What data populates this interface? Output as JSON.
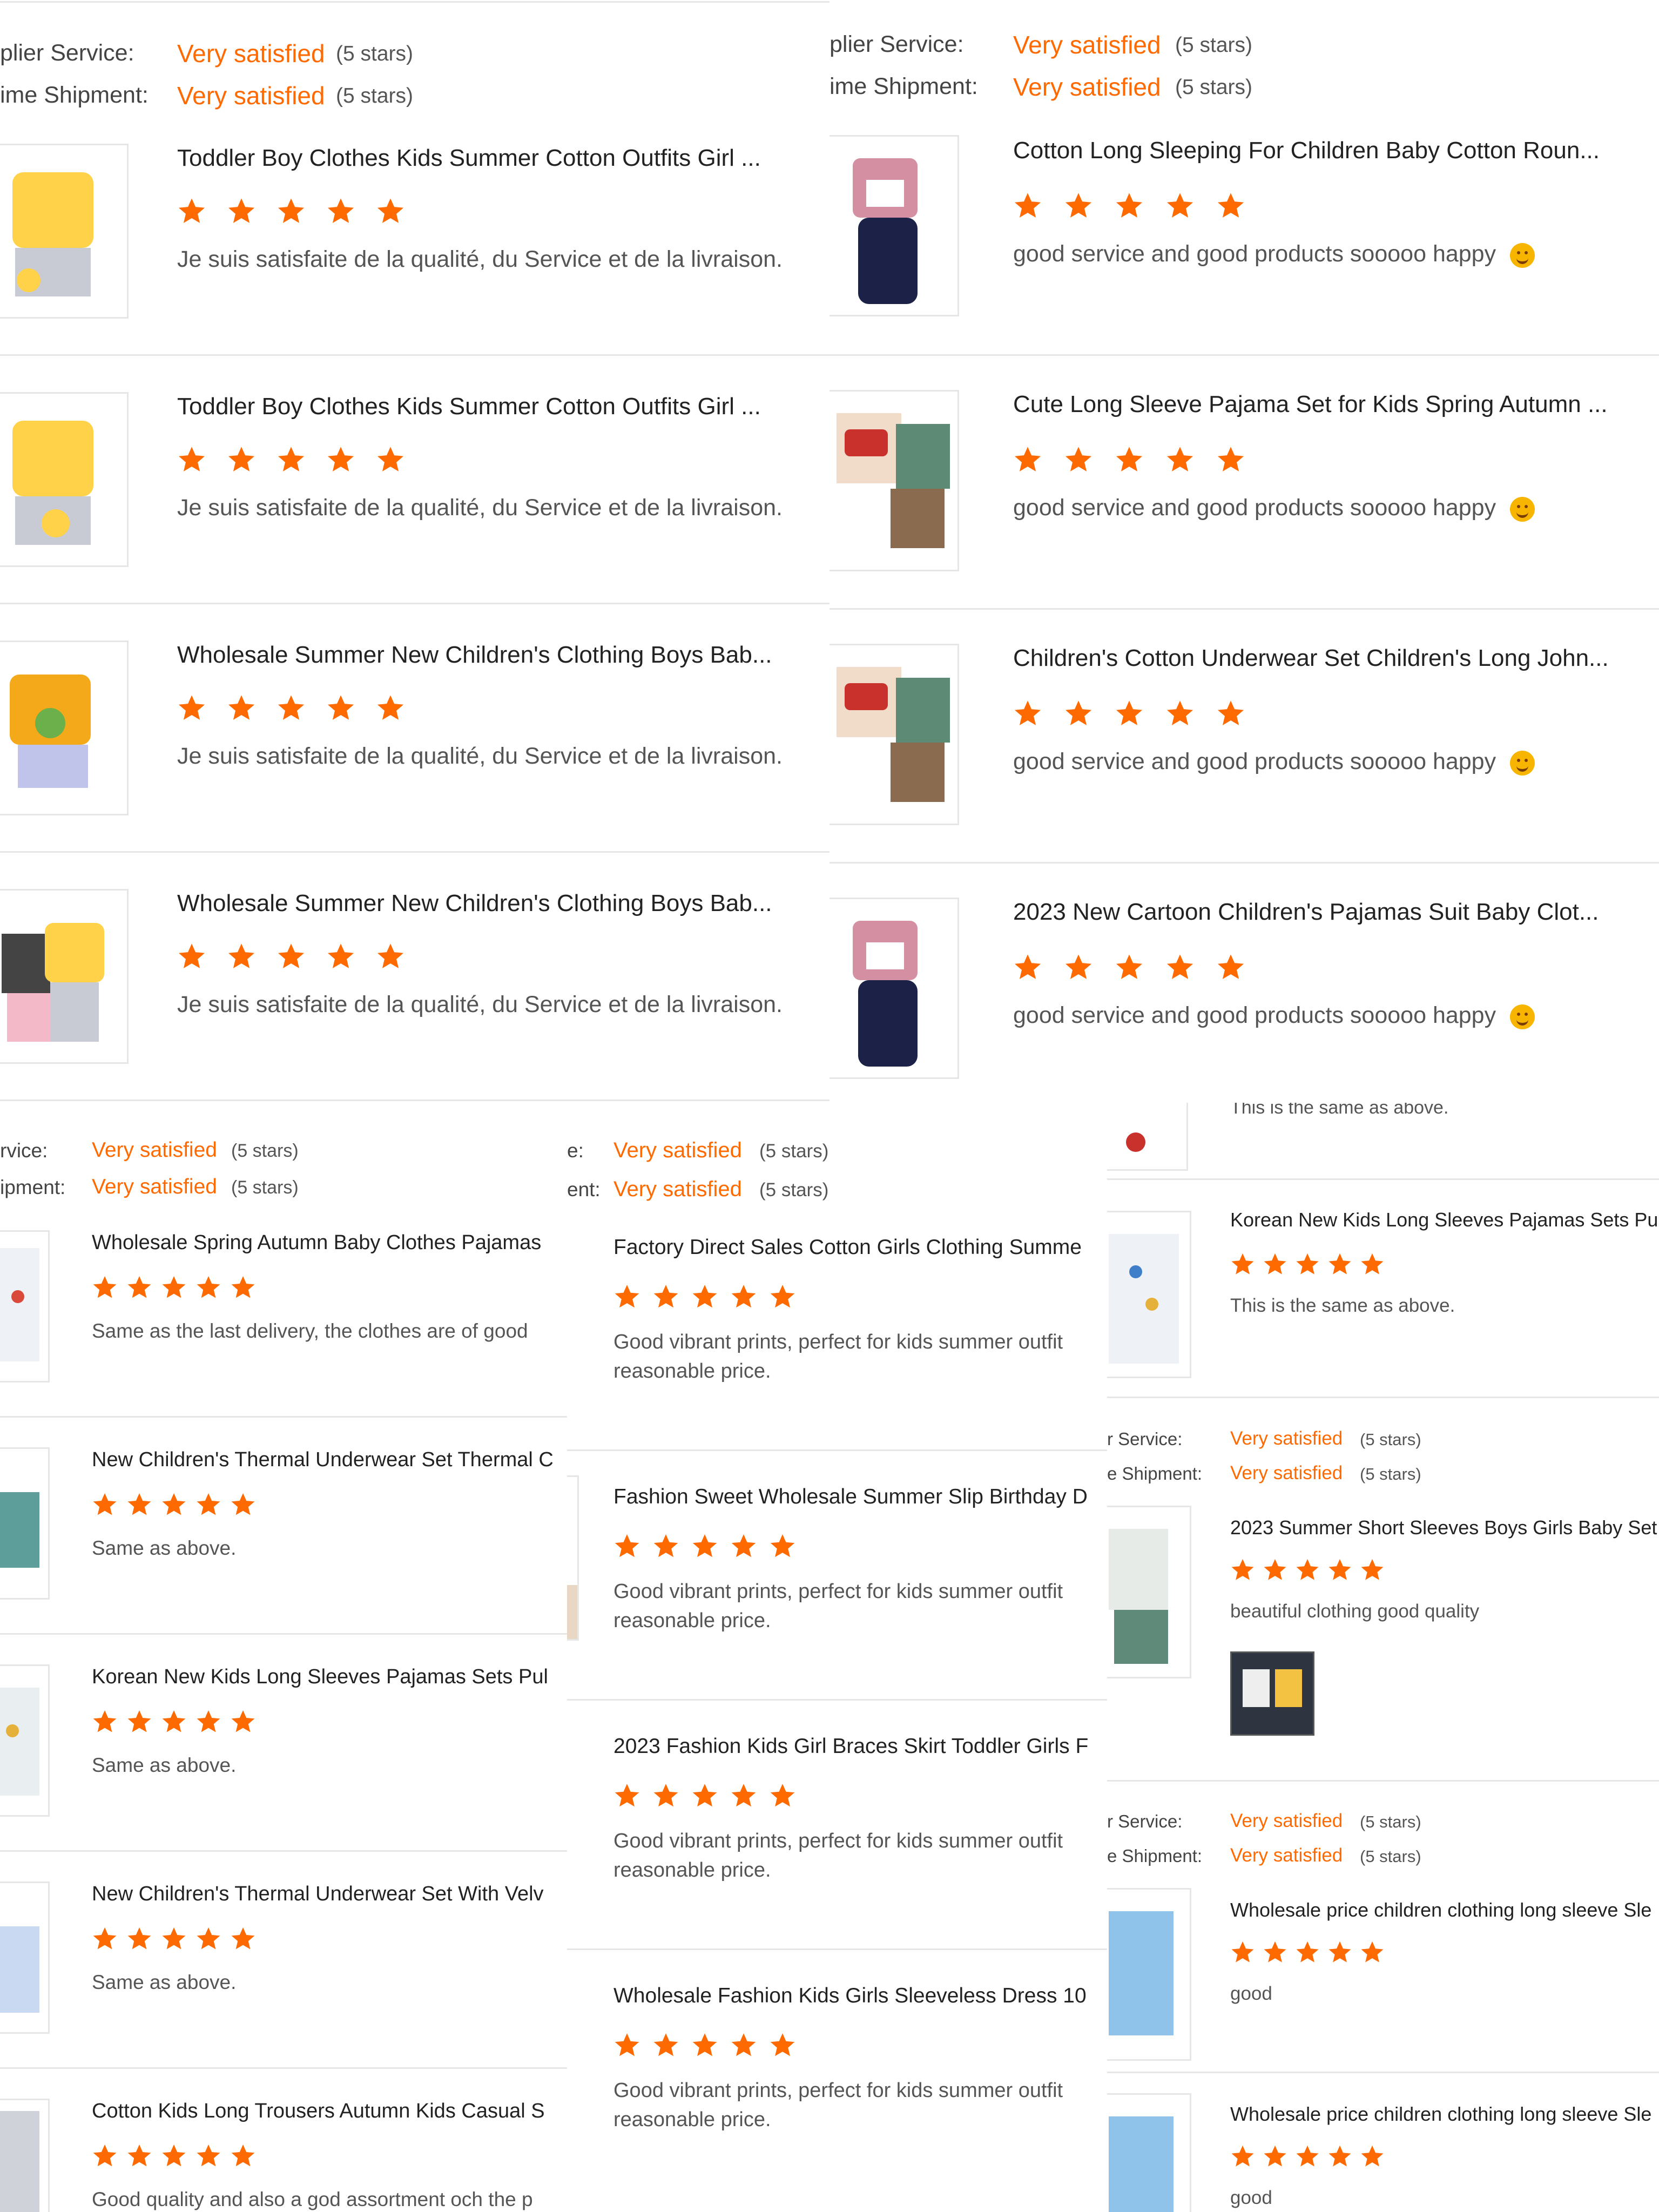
{
  "colors": {
    "accent": "#ff6a00",
    "divider": "#e6e6e6"
  },
  "panels": [
    {
      "labels": {
        "service": "plier Service:",
        "shipment": "ime Shipment:"
      },
      "ratings": {
        "service": "Very satisfied",
        "shipment": "Very satisfied",
        "count": "(5 stars)"
      },
      "items": [
        {
          "title": "Toddler Boy Clothes Kids Summer Cotton Outfits Girl ...",
          "stars": 5,
          "comment": "Je suis satisfaite de la qualité,  du Service et de la livraison."
        },
        {
          "title": "Toddler Boy Clothes Kids Summer Cotton Outfits Girl ...",
          "stars": 5,
          "comment": "Je suis satisfaite de la qualité,  du Service et de la livraison."
        },
        {
          "title": "Wholesale Summer New Children's Clothing Boys Bab...",
          "stars": 5,
          "comment": "Je suis satisfaite de la qualité,  du Service et de la livraison."
        },
        {
          "title": "Wholesale Summer New Children's Clothing Boys Bab...",
          "stars": 5,
          "comment": "Je suis satisfaite de la qualité,  du Service et de la livraison."
        }
      ]
    },
    {
      "labels": {
        "service": "plier Service:",
        "shipment": "ime Shipment:"
      },
      "ratings": {
        "service": "Very satisfied",
        "shipment": "Very satisfied",
        "count": "(5 stars)"
      },
      "items": [
        {
          "title": "Cotton Long Sleeping For Children Baby Cotton Roun...",
          "stars": 5,
          "comment": "good service and good products sooooo happy"
        },
        {
          "title": "Cute Long Sleeve Pajama Set for Kids Spring Autumn ...",
          "stars": 5,
          "comment": "good service and good products sooooo happy"
        },
        {
          "title": "Children's Cotton Underwear Set Children's Long John...",
          "stars": 5,
          "comment": "good service and good products sooooo happy"
        },
        {
          "title": "2023 New Cartoon Children's Pajamas Suit Baby Clot...",
          "stars": 5,
          "comment": "good service and good products sooooo happy"
        }
      ]
    },
    {
      "labels": {
        "service": "rvice:",
        "shipment": "ipment:"
      },
      "ratings": {
        "service": "Very satisfied",
        "shipment": "Very satisfied",
        "count": "(5 stars)"
      },
      "items": [
        {
          "title": "Wholesale Spring Autumn Baby Clothes Pajamas",
          "stars": 5,
          "comment": "Same as the last delivery, the clothes are of good"
        },
        {
          "title": "New Children's Thermal Underwear Set Thermal C",
          "stars": 5,
          "comment": "Same as above."
        },
        {
          "title": "Korean New Kids Long Sleeves Pajamas Sets Pul",
          "stars": 5,
          "comment": "Same as above."
        },
        {
          "title": "New Children's Thermal Underwear Set With Velv",
          "stars": 5,
          "comment": "Same as above."
        },
        {
          "title": "Cotton Kids Long Trousers Autumn Kids Casual S",
          "stars": 5,
          "comment": "Good quality and also a god assortment och the p"
        }
      ]
    },
    {
      "labels": {
        "service": "e:",
        "shipment": "ent:"
      },
      "ratings": {
        "service": "Very satisfied",
        "shipment": "Very satisfied",
        "count": "(5 stars)"
      },
      "items": [
        {
          "title": "Factory Direct Sales Cotton Girls Clothing Summe",
          "stars": 5,
          "comment": "Good vibrant prints, perfect for kids summer outfit",
          "comment2": "reasonable price."
        },
        {
          "title": "Fashion Sweet Wholesale Summer Slip Birthday D",
          "stars": 5,
          "comment": "Good vibrant prints, perfect for kids summer outfit",
          "comment2": "reasonable price."
        },
        {
          "title": "2023 Fashion Kids Girl Braces Skirt Toddler Girls F",
          "stars": 5,
          "comment": "Good vibrant prints, perfect for kids summer outfit",
          "comment2": "reasonable price."
        },
        {
          "title": "Wholesale Fashion Kids Girls Sleeveless Dress 10",
          "stars": 5,
          "comment": "Good vibrant prints, perfect for kids summer outfit",
          "comment2": "reasonable price."
        }
      ]
    },
    {
      "top_fragment": "This is the same as above.",
      "items": [
        {
          "title": "Korean New Kids Long Sleeves Pajamas Sets Pu",
          "stars": 5,
          "comment": "This is the same as above."
        }
      ],
      "groups": [
        {
          "labels": {
            "service": "r Service:",
            "shipment": "e Shipment:"
          },
          "ratings": {
            "service": "Very satisfied",
            "shipment": "Very satisfied",
            "count": "(5 stars)"
          },
          "title": "2023 Summer Short Sleeves Boys Girls Baby Set",
          "stars": 5,
          "comment": "beautiful  clothing good quality"
        },
        {
          "labels": {
            "service": "r Service:",
            "shipment": "e Shipment:"
          },
          "ratings": {
            "service": "Very satisfied",
            "shipment": "Very satisfied",
            "count": "(5 stars)"
          },
          "title": "Wholesale price children clothing long sleeve Sle",
          "stars": 5,
          "comment": "good"
        }
      ],
      "last": {
        "title": "Wholesale price children clothing long sleeve Sle",
        "stars": 5,
        "comment": "good"
      }
    }
  ]
}
